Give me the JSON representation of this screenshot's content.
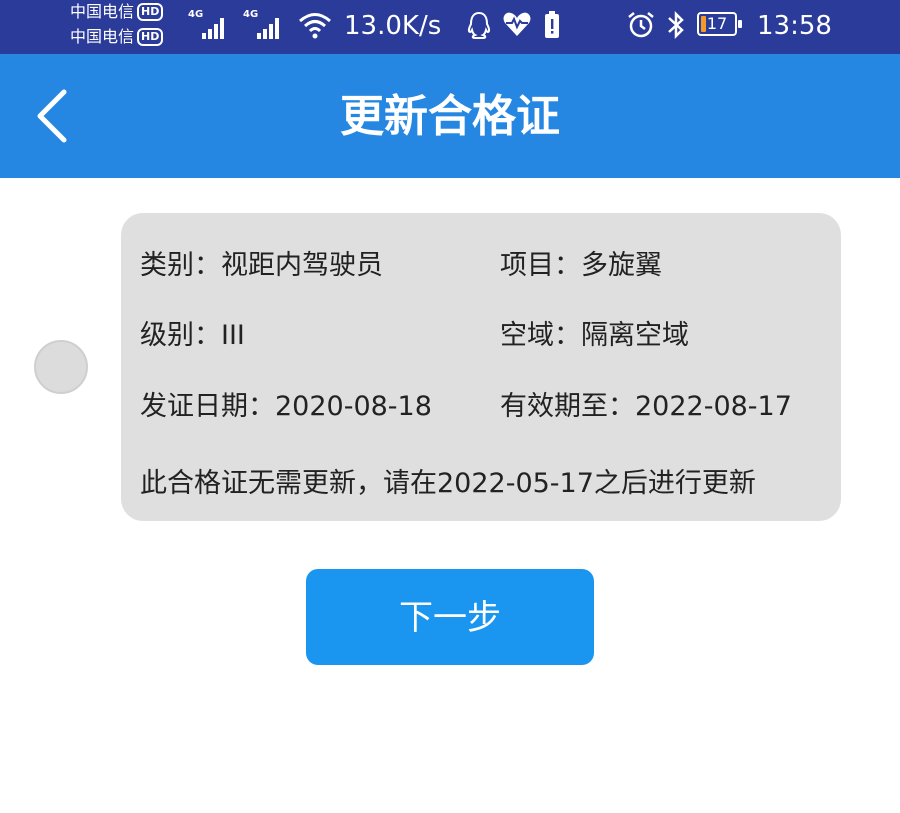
{
  "status_bar": {
    "carriers": [
      "中国电信",
      "中国电信"
    ],
    "hd_badge": "HD",
    "network_tags": [
      "4G",
      "4G"
    ],
    "net_speed": "13.0K/s",
    "battery_level": "17",
    "time": "13:58",
    "icons": [
      "signal-icon",
      "wifi-icon",
      "qq-icon",
      "health-icon",
      "battery-alert-icon",
      "alarm-icon",
      "bluetooth-icon",
      "battery-icon"
    ],
    "colors": {
      "background": "#2b3b9a",
      "battery_fill": "#f39a28"
    }
  },
  "header": {
    "title": "更新合格证",
    "back_icon": "chevron-left-icon",
    "color": "#2587e2"
  },
  "certificate": {
    "category": "类别：视距内驾驶员",
    "project": "项目：多旋翼",
    "level": "级别：III",
    "airspace": "空域：隔离空域",
    "issue_date": "发证日期：2020-08-18",
    "valid_until": "有效期至：2022-08-17",
    "note": "此合格证无需更新，请在2022-05-17之后进行更新",
    "selected": false
  },
  "actions": {
    "next_label": "下一步",
    "next_color": "#1b96f0"
  }
}
